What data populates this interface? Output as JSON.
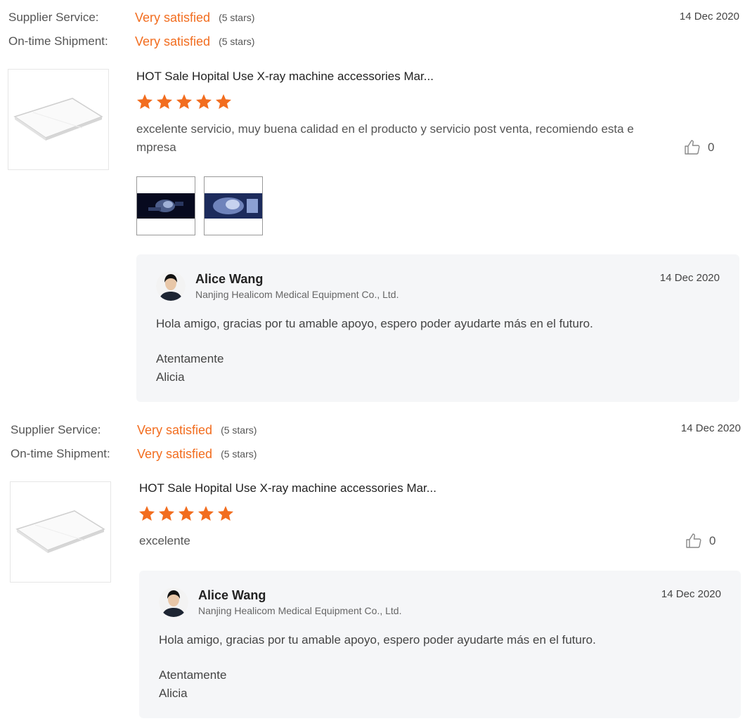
{
  "reviews": [
    {
      "supplier_service_label": "Supplier Service:",
      "supplier_service_value": "Very satisfied",
      "supplier_service_stars": "(5 stars)",
      "shipment_label": "On-time Shipment:",
      "shipment_value": "Very satisfied",
      "shipment_stars": "(5 stars)",
      "date": "14 Dec 2020",
      "product_title": "HOT Sale Hopital Use X-ray machine accessories Mar...",
      "star_rating": 5,
      "text": "excelente servicio, muy buena calidad en el producto y servicio post venta, recomiendo esta empresa",
      "likes": "0",
      "photo_count": 2,
      "reply": {
        "name": "Alice Wang",
        "company": "Nanjing Healicom Medical Equipment Co., Ltd.",
        "date": "14 Dec 2020",
        "text": "Hola amigo, gracias por tu amable apoyo, espero poder ayudarte más en el futuro.",
        "sign_line1": "Atentamente",
        "sign_line2": "Alicia"
      }
    },
    {
      "supplier_service_label": "Supplier Service:",
      "supplier_service_value": "Very satisfied",
      "supplier_service_stars": "(5 stars)",
      "shipment_label": "On-time Shipment:",
      "shipment_value": "Very satisfied",
      "shipment_stars": "(5 stars)",
      "date": "14 Dec 2020",
      "product_title": "HOT Sale Hopital Use X-ray machine accessories Mar...",
      "star_rating": 5,
      "text": "excelente",
      "likes": "0",
      "photo_count": 0,
      "reply": {
        "name": "Alice Wang",
        "company": "Nanjing Healicom Medical Equipment Co., Ltd.",
        "date": "14 Dec 2020",
        "text": "Hola amigo, gracias por tu amable apoyo, espero poder ayudarte más en el futuro.",
        "sign_line1": "Atentamente",
        "sign_line2": "Alicia"
      }
    }
  ],
  "colors": {
    "accent": "#f26d1f",
    "reply_bg": "#f5f6f8"
  },
  "icons": {
    "star": "star-icon",
    "like": "thumbs-up-icon"
  }
}
